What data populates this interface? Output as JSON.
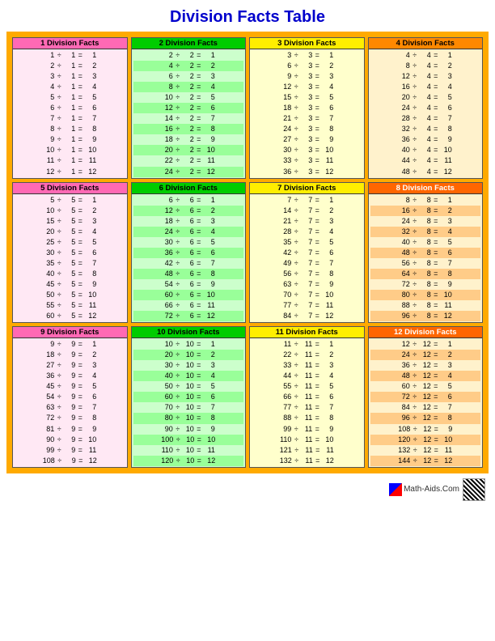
{
  "title": "Division Facts Table",
  "footer_text": "Math-Aids.Com",
  "sections": [
    {
      "id": 1,
      "header": "1 Division Facts",
      "divisor": 1,
      "rows": [
        "1 ÷ 1 = 1",
        "2 ÷ 1 = 2",
        "3 ÷ 1 = 3",
        "4 ÷ 1 = 4",
        "5 ÷ 1 = 5",
        "6 ÷ 1 = 6",
        "7 ÷ 1 = 7",
        "8 ÷ 1 = 8",
        "9 ÷ 1 = 9",
        "10 ÷ 1 = 10",
        "11 ÷ 1 = 11",
        "12 ÷ 1 = 12"
      ]
    },
    {
      "id": 2,
      "header": "2 Division Facts",
      "divisor": 2,
      "rows": [
        "2 ÷ 2 = 1",
        "4 ÷ 2 = 2",
        "6 ÷ 2 = 3",
        "8 ÷ 2 = 4",
        "10 ÷ 2 = 5",
        "12 ÷ 2 = 6",
        "14 ÷ 2 = 7",
        "16 ÷ 2 = 8",
        "18 ÷ 2 = 9",
        "20 ÷ 2 = 10",
        "22 ÷ 2 = 11",
        "24 ÷ 2 = 12"
      ]
    },
    {
      "id": 3,
      "header": "3 Division Facts",
      "divisor": 3,
      "rows": [
        "3 ÷ 3 = 1",
        "6 ÷ 3 = 2",
        "9 ÷ 3 = 3",
        "12 ÷ 3 = 4",
        "15 ÷ 3 = 5",
        "18 ÷ 3 = 6",
        "21 ÷ 3 = 7",
        "24 ÷ 3 = 8",
        "27 ÷ 3 = 9",
        "30 ÷ 3 = 10",
        "33 ÷ 3 = 11",
        "36 ÷ 3 = 12"
      ]
    },
    {
      "id": 4,
      "header": "4 Division Facts",
      "divisor": 4,
      "rows": [
        "4 ÷ 4 = 1",
        "8 ÷ 4 = 2",
        "12 ÷ 4 = 3",
        "16 ÷ 4 = 4",
        "20 ÷ 4 = 5",
        "24 ÷ 4 = 6",
        "28 ÷ 4 = 7",
        "32 ÷ 4 = 8",
        "36 ÷ 4 = 9",
        "40 ÷ 4 = 10",
        "44 ÷ 4 = 11",
        "48 ÷ 4 = 12"
      ]
    },
    {
      "id": 5,
      "header": "5 Division Facts",
      "divisor": 5,
      "rows": [
        "5 ÷ 5 = 1",
        "10 ÷ 5 = 2",
        "15 ÷ 5 = 3",
        "20 ÷ 5 = 4",
        "25 ÷ 5 = 5",
        "30 ÷ 5 = 6",
        "35 ÷ 5 = 7",
        "40 ÷ 5 = 8",
        "45 ÷ 5 = 9",
        "50 ÷ 5 = 10",
        "55 ÷ 5 = 11",
        "60 ÷ 5 = 12"
      ]
    },
    {
      "id": 6,
      "header": "6 Division Facts",
      "divisor": 6,
      "rows": [
        "6 ÷ 6 = 1",
        "12 ÷ 6 = 2",
        "18 ÷ 6 = 3",
        "24 ÷ 6 = 4",
        "30 ÷ 6 = 5",
        "36 ÷ 6 = 6",
        "42 ÷ 6 = 7",
        "48 ÷ 6 = 8",
        "54 ÷ 6 = 9",
        "60 ÷ 6 = 10",
        "66 ÷ 6 = 11",
        "72 ÷ 6 = 12"
      ]
    },
    {
      "id": 7,
      "header": "7 Division Facts",
      "divisor": 7,
      "rows": [
        "7 ÷ 7 = 1",
        "14 ÷ 7 = 2",
        "21 ÷ 7 = 3",
        "28 ÷ 7 = 4",
        "35 ÷ 7 = 5",
        "42 ÷ 7 = 6",
        "49 ÷ 7 = 7",
        "56 ÷ 7 = 8",
        "63 ÷ 7 = 9",
        "70 ÷ 7 = 10",
        "77 ÷ 7 = 11",
        "84 ÷ 7 = 12"
      ]
    },
    {
      "id": 8,
      "header": "8 Division Facts",
      "divisor": 8,
      "rows": [
        "8 ÷ 8 = 1",
        "16 ÷ 8 = 2",
        "24 ÷ 8 = 3",
        "32 ÷ 8 = 4",
        "40 ÷ 8 = 5",
        "48 ÷ 8 = 6",
        "56 ÷ 8 = 7",
        "64 ÷ 8 = 8",
        "72 ÷ 8 = 9",
        "80 ÷ 8 = 10",
        "88 ÷ 8 = 11",
        "96 ÷ 8 = 12"
      ]
    },
    {
      "id": 9,
      "header": "9 Division Facts",
      "divisor": 9,
      "rows": [
        "9 ÷ 9 = 1",
        "18 ÷ 9 = 2",
        "27 ÷ 9 = 3",
        "36 ÷ 9 = 4",
        "45 ÷ 9 = 5",
        "54 ÷ 9 = 6",
        "63 ÷ 9 = 7",
        "72 ÷ 9 = 8",
        "81 ÷ 9 = 9",
        "90 ÷ 9 = 10",
        "99 ÷ 9 = 11",
        "108 ÷ 9 = 12"
      ]
    },
    {
      "id": 10,
      "header": "10 Division Facts",
      "divisor": 10,
      "rows": [
        "10 ÷ 10 = 1",
        "20 ÷ 10 = 2",
        "30 ÷ 10 = 3",
        "40 ÷ 10 = 4",
        "50 ÷ 10 = 5",
        "60 ÷ 10 = 6",
        "70 ÷ 10 = 7",
        "80 ÷ 10 = 8",
        "90 ÷ 10 = 9",
        "100 ÷ 10 = 10",
        "110 ÷ 10 = 11",
        "120 ÷ 10 = 12"
      ]
    },
    {
      "id": 11,
      "header": "11 Division Facts",
      "divisor": 11,
      "rows": [
        "11 ÷ 11 = 1",
        "22 ÷ 11 = 2",
        "33 ÷ 11 = 3",
        "44 ÷ 11 = 4",
        "55 ÷ 11 = 5",
        "66 ÷ 11 = 6",
        "77 ÷ 11 = 7",
        "88 ÷ 11 = 8",
        "99 ÷ 11 = 9",
        "110 ÷ 11 = 10",
        "121 ÷ 11 = 11",
        "132 ÷ 11 = 12"
      ]
    },
    {
      "id": 12,
      "header": "12 Division Facts",
      "divisor": 12,
      "rows": [
        "12 ÷ 12 = 1",
        "24 ÷ 12 = 2",
        "36 ÷ 12 = 3",
        "48 ÷ 12 = 4",
        "60 ÷ 12 = 5",
        "72 ÷ 12 = 6",
        "84 ÷ 12 = 7",
        "96 ÷ 12 = 8",
        "108 ÷ 12 = 9",
        "120 ÷ 12 = 10",
        "132 ÷ 12 = 11",
        "144 ÷ 12 = 12"
      ]
    }
  ]
}
